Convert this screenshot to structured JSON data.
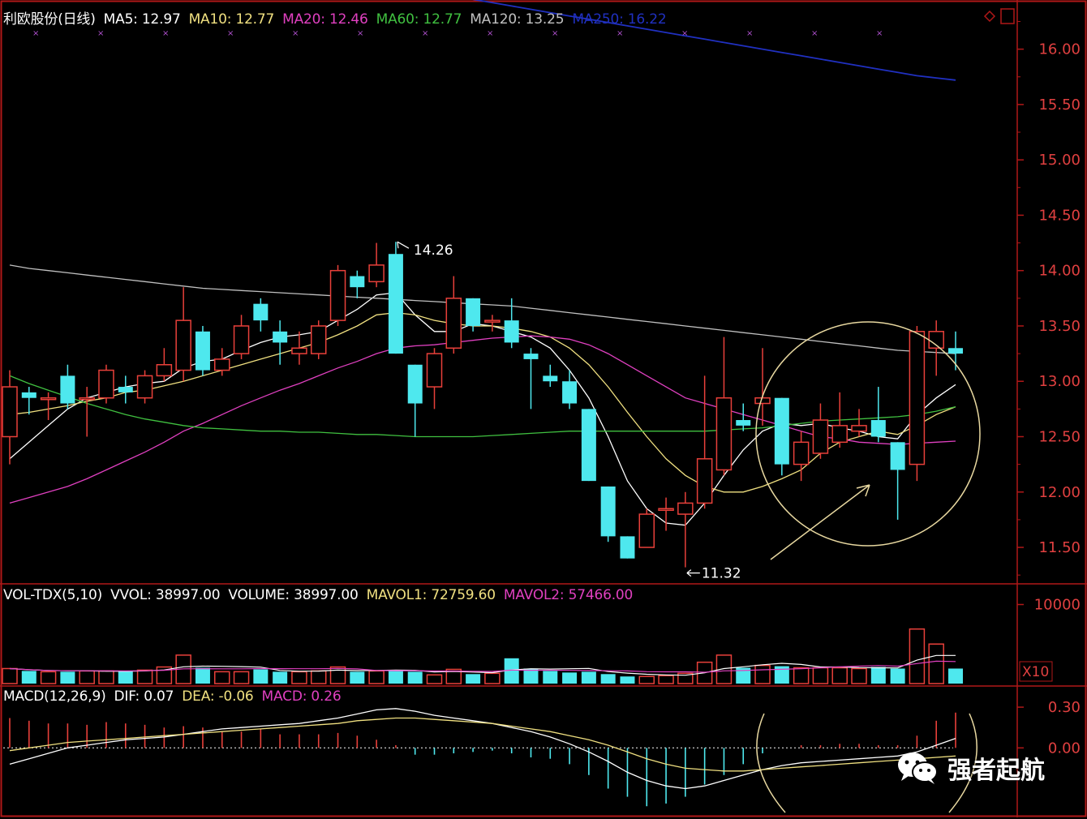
{
  "colors": {
    "background": "#000000",
    "frame": "#b01818",
    "up": "#e8403a",
    "down": "#4ee8ee",
    "ma5": "#ffffff",
    "ma10": "#f0e080",
    "ma20": "#e040c0",
    "ma60": "#40c040",
    "ma120": "#c0c0c0",
    "ma250": "#2030c0",
    "annotation": "#e8d8a0",
    "axis_text": "#e04040"
  },
  "price_panel": {
    "header": [
      {
        "text": "利欧股份(日线)",
        "color": "#ffffff"
      },
      {
        "text": "MA5: 12.97",
        "color": "#ffffff"
      },
      {
        "text": "MA10: 12.77",
        "color": "#f0e080"
      },
      {
        "text": "MA20: 12.46",
        "color": "#e040c0"
      },
      {
        "text": "MA60: 12.77",
        "color": "#40c040"
      },
      {
        "text": "MA120: 13.25",
        "color": "#c0c0c0"
      },
      {
        "text": "MA250: 16.22",
        "color": "#2030c0"
      }
    ],
    "high_label": "14.26",
    "low_label": "11.32"
  },
  "volume_panel": {
    "header": [
      {
        "text": "VOL-TDX(5,10)",
        "color": "#ffffff"
      },
      {
        "text": "VVOL: 38997.00",
        "color": "#ffffff"
      },
      {
        "text": "VOLUME: 38997.00",
        "color": "#ffffff"
      },
      {
        "text": "MAVOL1: 72759.60",
        "color": "#f0e080"
      },
      {
        "text": "MAVOL2: 57466.00",
        "color": "#e040c0"
      }
    ],
    "unit_label": "X10"
  },
  "macd_panel": {
    "header": [
      {
        "text": "MACD(12,26,9)",
        "color": "#ffffff"
      },
      {
        "text": "DIF: 0.07",
        "color": "#ffffff"
      },
      {
        "text": "DEA: -0.06",
        "color": "#f0e080"
      },
      {
        "text": "MACD: 0.26",
        "color": "#e040c0"
      }
    ]
  },
  "watermark": {
    "text": "强者起航",
    "icon": "wechat-icon"
  },
  "chart_data": [
    {
      "type": "candlestick",
      "ylim": [
        11.2,
        16.4
      ],
      "yticks": [
        "16.00",
        "15.50",
        "15.00",
        "14.50",
        "14.00",
        "13.50",
        "13.00",
        "12.50",
        "12.00",
        "11.50"
      ],
      "candles": [
        {
          "o": 12.5,
          "c": 12.95,
          "h": 13.1,
          "l": 12.25
        },
        {
          "o": 12.9,
          "c": 12.85,
          "h": 12.95,
          "l": 12.7
        },
        {
          "o": 12.85,
          "c": 12.85,
          "h": 12.9,
          "l": 12.65
        },
        {
          "o": 13.05,
          "c": 12.8,
          "h": 13.15,
          "l": 12.75
        },
        {
          "o": 12.85,
          "c": 12.85,
          "h": 12.95,
          "l": 12.5
        },
        {
          "o": 12.85,
          "c": 13.1,
          "h": 13.15,
          "l": 12.8
        },
        {
          "o": 12.95,
          "c": 12.9,
          "h": 13.05,
          "l": 12.8
        },
        {
          "o": 12.85,
          "c": 13.05,
          "h": 13.1,
          "l": 12.8
        },
        {
          "o": 13.05,
          "c": 13.15,
          "h": 13.3,
          "l": 13.0
        },
        {
          "o": 13.1,
          "c": 13.55,
          "h": 13.85,
          "l": 13.0
        },
        {
          "o": 13.45,
          "c": 13.1,
          "h": 13.5,
          "l": 13.05
        },
        {
          "o": 13.1,
          "c": 13.2,
          "h": 13.3,
          "l": 13.05
        },
        {
          "o": 13.25,
          "c": 13.5,
          "h": 13.6,
          "l": 13.2
        },
        {
          "o": 13.7,
          "c": 13.55,
          "h": 13.75,
          "l": 13.45
        },
        {
          "o": 13.45,
          "c": 13.35,
          "h": 13.55,
          "l": 13.15
        },
        {
          "o": 13.25,
          "c": 13.3,
          "h": 13.45,
          "l": 13.15
        },
        {
          "o": 13.25,
          "c": 13.5,
          "h": 13.55,
          "l": 13.2
        },
        {
          "o": 13.55,
          "c": 14.0,
          "h": 14.05,
          "l": 13.5
        },
        {
          "o": 13.95,
          "c": 13.85,
          "h": 14.0,
          "l": 13.75
        },
        {
          "o": 13.9,
          "c": 14.05,
          "h": 14.25,
          "l": 13.85
        },
        {
          "o": 14.15,
          "c": 13.25,
          "h": 14.26,
          "l": 13.25
        },
        {
          "o": 13.15,
          "c": 12.8,
          "h": 13.15,
          "l": 12.5
        },
        {
          "o": 12.95,
          "c": 13.25,
          "h": 13.3,
          "l": 12.75
        },
        {
          "o": 13.3,
          "c": 13.75,
          "h": 13.95,
          "l": 13.25
        },
        {
          "o": 13.75,
          "c": 13.5,
          "h": 13.75,
          "l": 13.45
        },
        {
          "o": 13.55,
          "c": 13.55,
          "h": 13.6,
          "l": 13.45
        },
        {
          "o": 13.55,
          "c": 13.35,
          "h": 13.75,
          "l": 13.3
        },
        {
          "o": 13.25,
          "c": 13.2,
          "h": 13.3,
          "l": 12.75
        },
        {
          "o": 13.05,
          "c": 13.0,
          "h": 13.15,
          "l": 12.95
        },
        {
          "o": 13.0,
          "c": 12.8,
          "h": 13.1,
          "l": 12.75
        },
        {
          "o": 12.75,
          "c": 12.1,
          "h": 12.75,
          "l": 12.1
        },
        {
          "o": 12.05,
          "c": 11.6,
          "h": 12.05,
          "l": 11.55
        },
        {
          "o": 11.6,
          "c": 11.4,
          "h": 11.6,
          "l": 11.4
        },
        {
          "o": 11.5,
          "c": 11.8,
          "h": 11.85,
          "l": 11.5
        },
        {
          "o": 11.85,
          "c": 11.85,
          "h": 11.95,
          "l": 11.65
        },
        {
          "o": 11.8,
          "c": 11.9,
          "h": 12.0,
          "l": 11.32
        },
        {
          "o": 11.9,
          "c": 12.3,
          "h": 13.05,
          "l": 11.85
        },
        {
          "o": 12.2,
          "c": 12.85,
          "h": 13.4,
          "l": 12.15
        },
        {
          "o": 12.65,
          "c": 12.6,
          "h": 12.8,
          "l": 12.55
        },
        {
          "o": 12.8,
          "c": 12.85,
          "h": 13.3,
          "l": 12.6
        },
        {
          "o": 12.85,
          "c": 12.25,
          "h": 12.85,
          "l": 12.15
        },
        {
          "o": 12.25,
          "c": 12.45,
          "h": 12.55,
          "l": 12.1
        },
        {
          "o": 12.35,
          "c": 12.65,
          "h": 12.8,
          "l": 12.3
        },
        {
          "o": 12.45,
          "c": 12.6,
          "h": 12.9,
          "l": 12.4
        },
        {
          "o": 12.55,
          "c": 12.6,
          "h": 12.75,
          "l": 12.5
        },
        {
          "o": 12.65,
          "c": 12.5,
          "h": 12.95,
          "l": 12.45
        },
        {
          "o": 12.45,
          "c": 12.2,
          "h": 12.45,
          "l": 11.75
        },
        {
          "o": 12.25,
          "c": 13.45,
          "h": 13.5,
          "l": 12.1
        },
        {
          "o": 13.3,
          "c": 13.45,
          "h": 13.55,
          "l": 13.05
        },
        {
          "o": 13.3,
          "c": 13.25,
          "h": 13.45,
          "l": 13.1
        }
      ],
      "ma_series": [
        {
          "name": "MA5",
          "color": "#ffffff",
          "values": [
            12.3,
            12.45,
            12.6,
            12.75,
            12.85,
            12.9,
            12.95,
            12.98,
            13.0,
            13.12,
            13.18,
            13.2,
            13.28,
            13.35,
            13.4,
            13.42,
            13.45,
            13.55,
            13.65,
            13.78,
            13.8,
            13.6,
            13.45,
            13.45,
            13.52,
            13.5,
            13.45,
            13.4,
            13.3,
            13.1,
            12.85,
            12.5,
            12.1,
            11.85,
            11.72,
            11.7,
            11.9,
            12.15,
            12.38,
            12.55,
            12.62,
            12.6,
            12.62,
            12.58,
            12.55,
            12.5,
            12.48,
            12.7,
            12.85,
            12.97
          ]
        },
        {
          "name": "MA10",
          "color": "#f0e080",
          "values": [
            12.7,
            12.72,
            12.75,
            12.78,
            12.82,
            12.85,
            12.9,
            12.92,
            12.96,
            13.0,
            13.05,
            13.1,
            13.15,
            13.2,
            13.25,
            13.3,
            13.35,
            13.42,
            13.5,
            13.6,
            13.62,
            13.6,
            13.55,
            13.52,
            13.5,
            13.5,
            13.48,
            13.45,
            13.4,
            13.3,
            13.15,
            12.95,
            12.72,
            12.5,
            12.3,
            12.15,
            12.05,
            12.0,
            12.0,
            12.05,
            12.12,
            12.2,
            12.35,
            12.45,
            12.5,
            12.55,
            12.52,
            12.6,
            12.7,
            12.77
          ]
        },
        {
          "name": "MA20",
          "color": "#e040c0",
          "values": [
            11.9,
            11.95,
            12.0,
            12.05,
            12.12,
            12.2,
            12.28,
            12.36,
            12.45,
            12.55,
            12.62,
            12.7,
            12.78,
            12.85,
            12.92,
            12.98,
            13.05,
            13.12,
            13.18,
            13.25,
            13.3,
            13.32,
            13.33,
            13.35,
            13.37,
            13.39,
            13.4,
            13.41,
            13.4,
            13.38,
            13.33,
            13.25,
            13.15,
            13.05,
            12.95,
            12.85,
            12.8,
            12.75,
            12.7,
            12.65,
            12.6,
            12.55,
            12.5,
            12.48,
            12.45,
            12.44,
            12.43,
            12.44,
            12.45,
            12.46
          ]
        },
        {
          "name": "MA60",
          "color": "#40c040",
          "values": [
            13.05,
            12.98,
            12.92,
            12.86,
            12.8,
            12.75,
            12.7,
            12.66,
            12.63,
            12.6,
            12.58,
            12.57,
            12.56,
            12.55,
            12.55,
            12.54,
            12.54,
            12.53,
            12.52,
            12.52,
            12.51,
            12.5,
            12.5,
            12.5,
            12.5,
            12.51,
            12.52,
            12.53,
            12.54,
            12.55,
            12.55,
            12.55,
            12.55,
            12.55,
            12.55,
            12.55,
            12.55,
            12.56,
            12.57,
            12.58,
            12.6,
            12.62,
            12.64,
            12.65,
            12.66,
            12.67,
            12.68,
            12.7,
            12.73,
            12.77
          ]
        },
        {
          "name": "MA120",
          "color": "#c0c0c0",
          "values": [
            14.05,
            14.02,
            14.0,
            13.98,
            13.96,
            13.94,
            13.92,
            13.9,
            13.88,
            13.86,
            13.84,
            13.83,
            13.82,
            13.81,
            13.8,
            13.79,
            13.78,
            13.77,
            13.76,
            13.75,
            13.74,
            13.73,
            13.72,
            13.71,
            13.7,
            13.69,
            13.68,
            13.66,
            13.64,
            13.62,
            13.6,
            13.58,
            13.56,
            13.54,
            13.52,
            13.5,
            13.48,
            13.46,
            13.44,
            13.42,
            13.4,
            13.38,
            13.36,
            13.34,
            13.32,
            13.3,
            13.28,
            13.27,
            13.26,
            13.25
          ]
        },
        {
          "name": "MA250",
          "color": "#2030c0",
          "values": [
            16.78,
            16.78,
            16.78,
            16.77,
            16.77,
            16.76,
            16.76,
            16.75,
            16.75,
            16.74,
            16.74,
            16.73,
            16.73,
            16.72,
            16.71,
            16.7,
            16.68,
            16.66,
            16.63,
            16.6,
            16.57,
            16.54,
            16.51,
            16.48,
            16.45,
            16.42,
            16.39,
            16.36,
            16.33,
            16.3,
            16.27,
            16.24,
            16.21,
            16.18,
            16.15,
            16.12,
            16.09,
            16.06,
            16.03,
            16.0,
            15.97,
            15.94,
            15.91,
            15.88,
            15.85,
            15.82,
            15.79,
            15.76,
            15.74,
            15.72
          ]
        }
      ]
    },
    {
      "type": "bar",
      "title": "VOL-TDX(5,10)",
      "ylim": [
        0,
        12000
      ],
      "yticks": [
        "10000"
      ],
      "values": [
        1900,
        1600,
        1500,
        1500,
        1600,
        1600,
        1600,
        1700,
        2100,
        3600,
        2000,
        1500,
        1500,
        1800,
        1500,
        1500,
        1600,
        2100,
        1500,
        1600,
        1700,
        1500,
        1100,
        1800,
        1200,
        1300,
        3200,
        1900,
        1600,
        1400,
        1500,
        1200,
        900,
        900,
        1000,
        1300,
        2700,
        3600,
        2000,
        2300,
        2200,
        2000,
        2000,
        2000,
        1900,
        2100,
        1900,
        6900,
        5000,
        1900
      ]
    },
    {
      "type": "bar",
      "title": "MACD(12,26,9)",
      "ylim": [
        -0.5,
        0.42
      ],
      "yticks": [
        "0.30",
        "0.00"
      ],
      "values": [
        0.22,
        0.2,
        0.18,
        0.18,
        0.17,
        0.19,
        0.18,
        0.17,
        0.15,
        0.16,
        0.15,
        0.12,
        0.12,
        0.14,
        0.1,
        0.1,
        0.1,
        0.11,
        0.09,
        0.06,
        0.02,
        -0.05,
        -0.05,
        -0.04,
        -0.03,
        -0.02,
        -0.04,
        -0.07,
        -0.08,
        -0.12,
        -0.2,
        -0.3,
        -0.36,
        -0.43,
        -0.41,
        -0.36,
        -0.27,
        -0.2,
        -0.12,
        -0.04,
        0.0,
        0.02,
        0.02,
        0.03,
        0.03,
        0.02,
        0.02,
        0.09,
        0.2,
        0.26
      ],
      "lines": [
        {
          "name": "DIF",
          "color": "#ffffff",
          "values": [
            -0.12,
            -0.08,
            -0.04,
            0.0,
            0.02,
            0.04,
            0.06,
            0.07,
            0.08,
            0.1,
            0.12,
            0.14,
            0.15,
            0.16,
            0.17,
            0.18,
            0.2,
            0.22,
            0.25,
            0.28,
            0.29,
            0.27,
            0.24,
            0.22,
            0.2,
            0.18,
            0.15,
            0.12,
            0.08,
            0.03,
            -0.03,
            -0.1,
            -0.18,
            -0.24,
            -0.28,
            -0.3,
            -0.28,
            -0.24,
            -0.2,
            -0.16,
            -0.13,
            -0.11,
            -0.1,
            -0.09,
            -0.08,
            -0.07,
            -0.06,
            -0.03,
            0.02,
            0.07
          ]
        },
        {
          "name": "DEA",
          "color": "#f0e080",
          "values": [
            -0.02,
            0.0,
            0.02,
            0.04,
            0.05,
            0.06,
            0.07,
            0.08,
            0.09,
            0.1,
            0.11,
            0.12,
            0.13,
            0.14,
            0.15,
            0.16,
            0.17,
            0.18,
            0.2,
            0.21,
            0.22,
            0.22,
            0.21,
            0.2,
            0.19,
            0.18,
            0.16,
            0.14,
            0.12,
            0.09,
            0.06,
            0.02,
            -0.03,
            -0.08,
            -0.12,
            -0.15,
            -0.16,
            -0.17,
            -0.17,
            -0.16,
            -0.15,
            -0.14,
            -0.13,
            -0.12,
            -0.11,
            -0.1,
            -0.09,
            -0.08,
            -0.07,
            -0.06
          ]
        }
      ]
    }
  ]
}
